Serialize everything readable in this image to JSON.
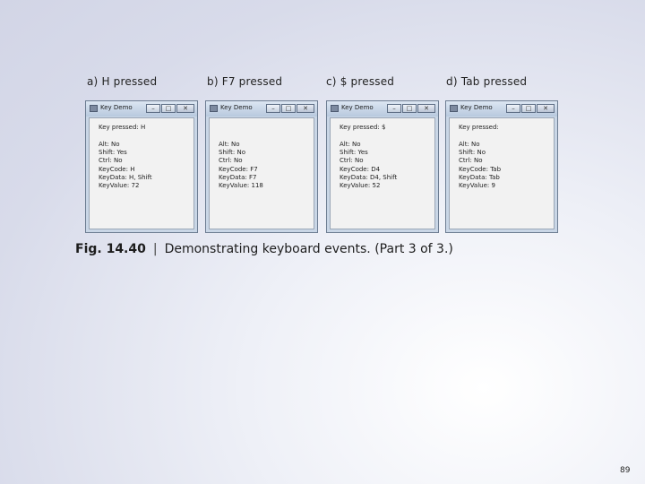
{
  "panels": [
    {
      "caption": "a) H pressed",
      "window_title": "Key Demo",
      "pressed": "Key pressed: H",
      "lines": [
        "Alt: No",
        "Shift: Yes",
        "Ctrl: No",
        "KeyCode: H",
        "KeyData: H, Shift",
        "KeyValue: 72"
      ]
    },
    {
      "caption": "b) F7 pressed",
      "window_title": "Key Demo",
      "pressed": "",
      "lines": [
        "Alt: No",
        "Shift: No",
        "Ctrl: No",
        "KeyCode: F7",
        "KeyData: F7",
        "KeyValue: 118"
      ]
    },
    {
      "caption": "c) $ pressed",
      "window_title": "Key Demo",
      "pressed": "Key pressed: $",
      "lines": [
        "Alt: No",
        "Shift: Yes",
        "Ctrl: No",
        "KeyCode: D4",
        "KeyData: D4, Shift",
        "KeyValue: 52"
      ]
    },
    {
      "caption": "d) Tab pressed",
      "window_title": "Key Demo",
      "pressed": "Key pressed:",
      "lines": [
        "Alt: No",
        "Shift: No",
        "Ctrl: No",
        "KeyCode: Tab",
        "KeyData: Tab",
        "KeyValue: 9"
      ]
    }
  ],
  "window_buttons": {
    "minimize": "–",
    "maximize": "□",
    "close": "✕"
  },
  "figure": {
    "label": "Fig. 14.40",
    "separator": "|",
    "text": "Demonstrating keyboard events. (Part 3 of 3.)"
  },
  "page_number": "89"
}
